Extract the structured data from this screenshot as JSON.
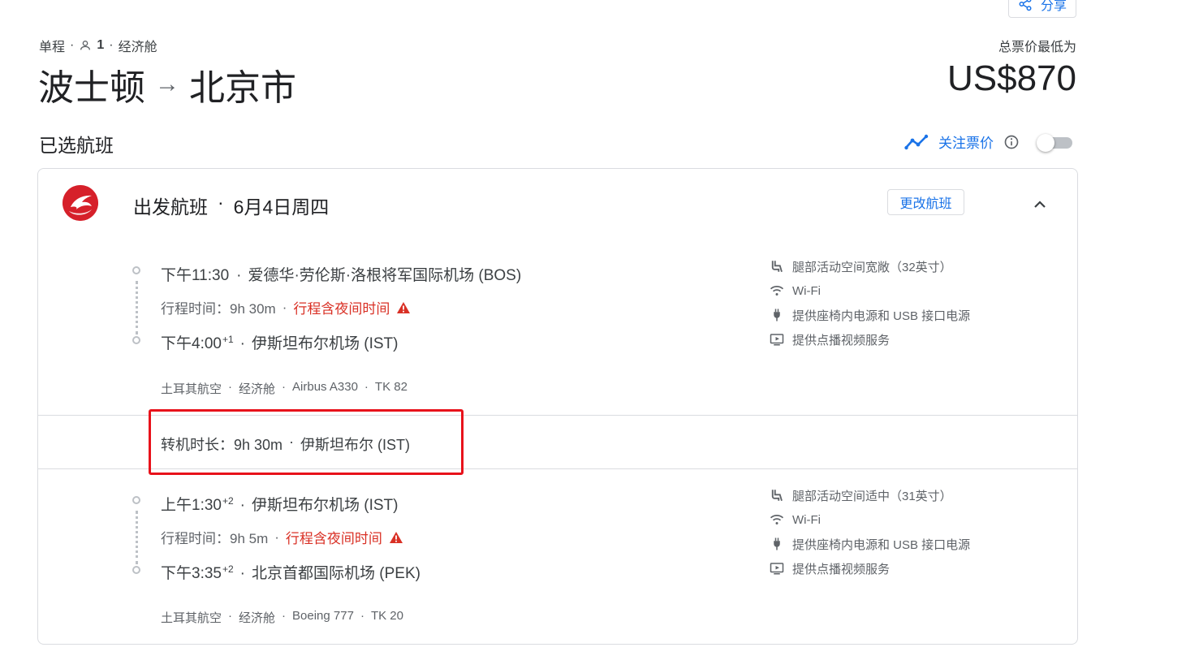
{
  "share": {
    "label": "分享"
  },
  "trip": {
    "type": "单程",
    "passengers": "1",
    "cabin": "经济舱",
    "sep": "·"
  },
  "route": {
    "from": "波士顿",
    "arrow": "→",
    "to": "北京市"
  },
  "price": {
    "label": "总票价最低为",
    "value": "US$870"
  },
  "selected_title": "已选航班",
  "track": {
    "label": "关注票价"
  },
  "departure": {
    "title": "出发航班",
    "sep": "·",
    "date": "6月4日周四",
    "change_label": "更改航班"
  },
  "segments": [
    {
      "dep_time": "下午11:30",
      "dep_sup": "",
      "dep_airport": "爱德华·劳伦斯·洛根将军国际机场 (BOS)",
      "duration_label": "行程时间：9h 30m",
      "overnight": "行程含夜间时间",
      "arr_time": "下午4:00",
      "arr_sup": "+1",
      "arr_airport": "伊斯坦布尔机场 (IST)",
      "details": [
        "土耳其航空",
        "经济舱",
        "Airbus A330",
        "TK 82"
      ],
      "amenities": [
        {
          "icon": "legroom-icon",
          "text": "腿部活动空间宽敞（32英寸）"
        },
        {
          "icon": "wifi-icon",
          "text": "Wi-Fi"
        },
        {
          "icon": "power-icon",
          "text": "提供座椅内电源和 USB 接口电源"
        },
        {
          "icon": "video-icon",
          "text": "提供点播视频服务"
        }
      ]
    },
    {
      "dep_time": "上午1:30",
      "dep_sup": "+2",
      "dep_airport": "伊斯坦布尔机场 (IST)",
      "duration_label": "行程时间：9h 5m",
      "overnight": "行程含夜间时间",
      "arr_time": "下午3:35",
      "arr_sup": "+2",
      "arr_airport": "北京首都国际机场 (PEK)",
      "details": [
        "土耳其航空",
        "经济舱",
        "Boeing 777",
        "TK 20"
      ],
      "amenities": [
        {
          "icon": "legroom-icon",
          "text": "腿部活动空间适中（31英寸）"
        },
        {
          "icon": "wifi-icon",
          "text": "Wi-Fi"
        },
        {
          "icon": "power-icon",
          "text": "提供座椅内电源和 USB 接口电源"
        },
        {
          "icon": "video-icon",
          "text": "提供点播视频服务"
        }
      ]
    }
  ],
  "layover": {
    "label": "转机时长：9h 30m",
    "place": "伊斯坦布尔 (IST)"
  },
  "colors": {
    "accent": "#1a73e8",
    "warning": "#d93025",
    "highlight": "#e8121b",
    "airline_red": "#d6202a"
  }
}
